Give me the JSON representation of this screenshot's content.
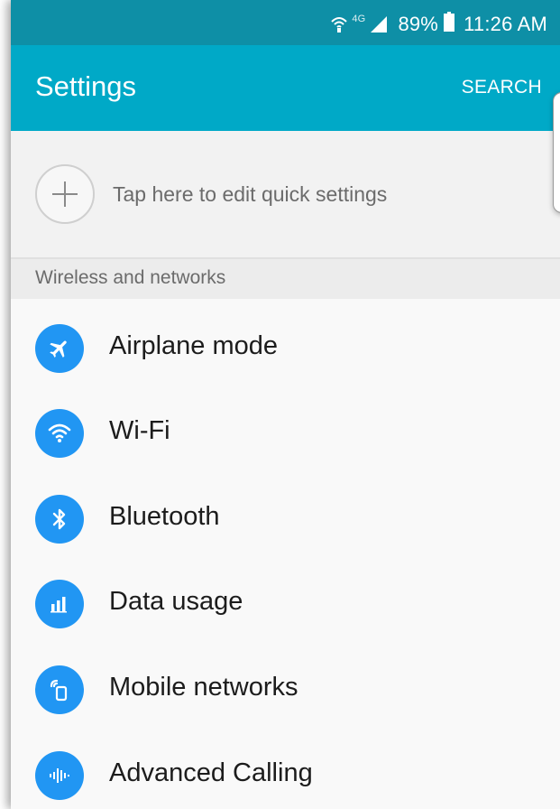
{
  "status_bar": {
    "network": "4G",
    "battery": "89%",
    "time": "11:26 AM"
  },
  "action_bar": {
    "title": "Settings",
    "search_label": "SEARCH"
  },
  "quick_settings": {
    "label": "Tap here to edit quick settings"
  },
  "section": {
    "title": "Wireless and networks"
  },
  "items": [
    {
      "label": "Airplane mode",
      "icon": "airplane-icon"
    },
    {
      "label": "Wi-Fi",
      "icon": "wifi-icon"
    },
    {
      "label": "Bluetooth",
      "icon": "bluetooth-icon"
    },
    {
      "label": "Data usage",
      "icon": "data-usage-icon"
    },
    {
      "label": "Mobile networks",
      "icon": "mobile-networks-icon"
    },
    {
      "label": "Advanced Calling",
      "icon": "advanced-calling-icon"
    }
  ],
  "colors": {
    "status_bar": "#0e8fa6",
    "action_bar": "#00a9c7",
    "icon_bg": "#2196f3"
  }
}
